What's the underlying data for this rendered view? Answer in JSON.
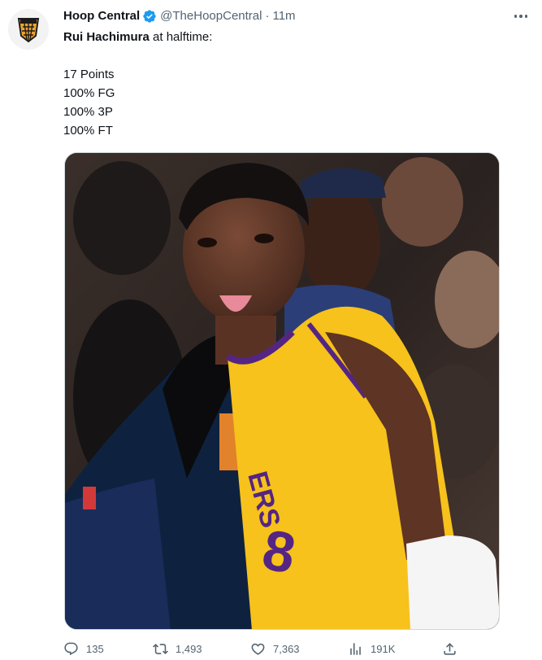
{
  "tweet": {
    "author_name": "Hoop Central",
    "handle": "@TheHoopCentral",
    "separator": "·",
    "time": "11m",
    "text": {
      "bold_name": "Rui Hachimura",
      "line1_rest": " at halftime:",
      "stats": [
        "17 Points",
        "100% FG",
        "100% 3P",
        "100% FT"
      ]
    },
    "actions": {
      "replies": "135",
      "retweets": "1,493",
      "likes": "7,363",
      "views": "191K"
    }
  },
  "colors": {
    "text_primary": "#0f1419",
    "text_secondary": "#536471",
    "verified_blue": "#1d9bf0",
    "lakers_gold": "#f6c21b",
    "lakers_purple": "#552583",
    "nuggets_navy": "#0e2240"
  },
  "icons": {
    "verified": "verified-badge-icon",
    "more": "more-dots-icon",
    "reply": "reply-icon",
    "retweet": "retweet-icon",
    "like": "heart-icon",
    "views": "views-chart-icon",
    "share": "share-icon"
  }
}
